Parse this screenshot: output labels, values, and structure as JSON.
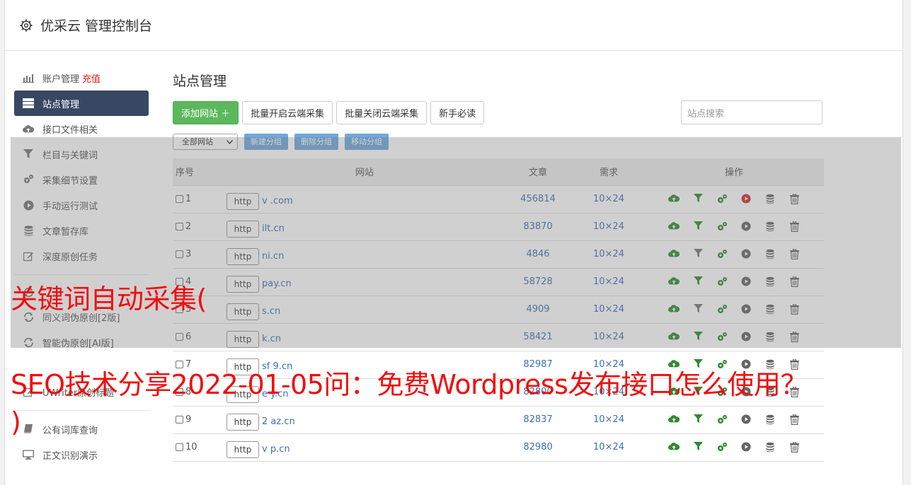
{
  "header": {
    "title": "优采云 管理控制台"
  },
  "sidebar": {
    "items": [
      {
        "label": "账户管理",
        "extra": "充值",
        "icon": "bar-chart-icon"
      },
      {
        "label": "站点管理",
        "icon": "server-icon",
        "active": true
      },
      {
        "label": "接口文件相关",
        "icon": "cloud-upload-icon"
      },
      {
        "label": "栏目与关键词",
        "icon": "filter-icon"
      },
      {
        "label": "采集细节设置",
        "icon": "gears-icon"
      },
      {
        "label": "手动运行测试",
        "icon": "play-circle-icon"
      },
      {
        "label": "文章暂存库",
        "icon": "database-icon"
      },
      {
        "label": "深度原创任务",
        "icon": "edit-icon"
      }
    ],
    "items2": [
      {
        "label": "同义词伪原创[2版]",
        "icon": "refresh-icon"
      },
      {
        "label": "智能伪原创[AI版]",
        "icon": "refresh-icon"
      }
    ],
    "items3": [
      {
        "label": "UWriter原创标题",
        "icon": "edit-icon"
      }
    ],
    "items4": [
      {
        "label": "公有词库查询",
        "icon": "book-icon"
      },
      {
        "label": "正文识别演示",
        "icon": "monitor-icon"
      }
    ]
  },
  "main": {
    "title": "站点管理",
    "buttons": {
      "add": "添加网站 ＋",
      "batch_on": "批量开启云端采集",
      "batch_off": "批量关闭云端采集",
      "guide": "新手必读"
    },
    "search_placeholder": "站点搜索",
    "group_select": "全部网站",
    "group_buttons": {
      "new": "新建分组",
      "delete": "删除分组",
      "move": "移动分组"
    },
    "columns": {
      "no": "序号",
      "site": "网站",
      "articles": "文章",
      "demand": "需求",
      "ops": "操作"
    },
    "rows": [
      {
        "no": "1",
        "proto": "http",
        "domain": "v              .com",
        "articles": "456814",
        "demand": "10×24",
        "filter_green": true,
        "run_red": true
      },
      {
        "no": "2",
        "proto": "http",
        "domain": "        ilt.cn",
        "articles": "83870",
        "demand": "10×24",
        "filter_green": true
      },
      {
        "no": "3",
        "proto": "http",
        "domain": "        ni.cn",
        "articles": "4846",
        "demand": "10×24",
        "filter_green": false
      },
      {
        "no": "4",
        "proto": "http",
        "domain": "        pay.cn",
        "articles": "58728",
        "demand": "10×24",
        "filter_green": true
      },
      {
        "no": "5",
        "proto": "http",
        "domain": "        s.cn",
        "articles": "4909",
        "demand": "10×24",
        "filter_green": false
      },
      {
        "no": "6",
        "proto": "http",
        "domain": "        k.cn",
        "articles": "58421",
        "demand": "10×24",
        "filter_green": true
      },
      {
        "no": "7",
        "proto": "http",
        "domain": "sf   9.cn",
        "articles": "82987",
        "demand": "10×24",
        "filter_green": true
      },
      {
        "no": "8",
        "proto": "http",
        "domain": "e      y.cn",
        "articles": "82800",
        "demand": "10×24",
        "filter_green": true
      },
      {
        "no": "9",
        "proto": "http",
        "domain": "2     az.cn",
        "articles": "82837",
        "demand": "10×24",
        "filter_green": true
      },
      {
        "no": "10",
        "proto": "http",
        "domain": "v     p.cn",
        "articles": "82980",
        "demand": "10×24",
        "filter_green": true
      }
    ]
  },
  "watermark": {
    "line1": "关键词自动采集(",
    "line2": "SEO技术分享2022-01-05问：免费Wordpress发布接口怎么使用？",
    "line3": ")"
  },
  "colors": {
    "active_nav": "#384863",
    "green_button": "#5cb85c",
    "link": "#3b6fb6",
    "watermark": "#f00e0e",
    "charge": "#e0201a"
  }
}
